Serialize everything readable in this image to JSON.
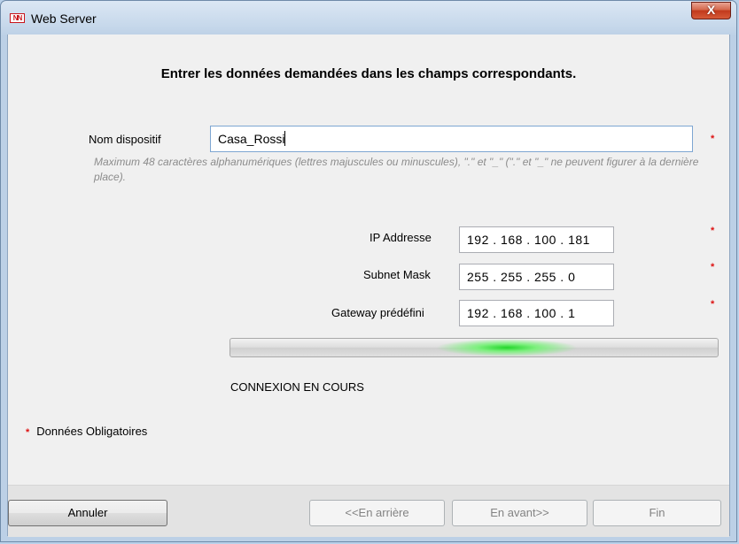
{
  "window": {
    "title": "Web Server",
    "close_glyph": "X",
    "app_icon": "NN-logo-icon"
  },
  "form": {
    "heading": "Entrer les données demandées dans les champs correspondants.",
    "device_name_label": "Nom dispositif",
    "device_name_value": "Casa_Rossi",
    "device_name_hint": "Maximum 48 caractères alphanumériques (lettres majuscules ou minuscules), \".\" et \"_\" (\".\" et \"_\" ne peuvent figurer à la dernière place).",
    "ip_label": "IP Addresse",
    "ip_value": "192 . 168  . 100 . 181",
    "subnet_label": "Subnet Mask",
    "subnet_value": "255 . 255  . 255 .  0",
    "gateway_label": "Gateway prédéfini",
    "gateway_value": "192 . 168  . 100 .  1",
    "required_star": "*",
    "required_color": "#dd1111"
  },
  "progress": {
    "status": "CONNEXION EN COURS",
    "indicator": "marquee",
    "glow_color": "#22d62a"
  },
  "legend": {
    "star": "*",
    "text": "Données Obligatoires"
  },
  "buttons": {
    "cancel": "Annuler",
    "back": "<<En arrière",
    "next": "En avant>>",
    "finish": "Fin"
  }
}
